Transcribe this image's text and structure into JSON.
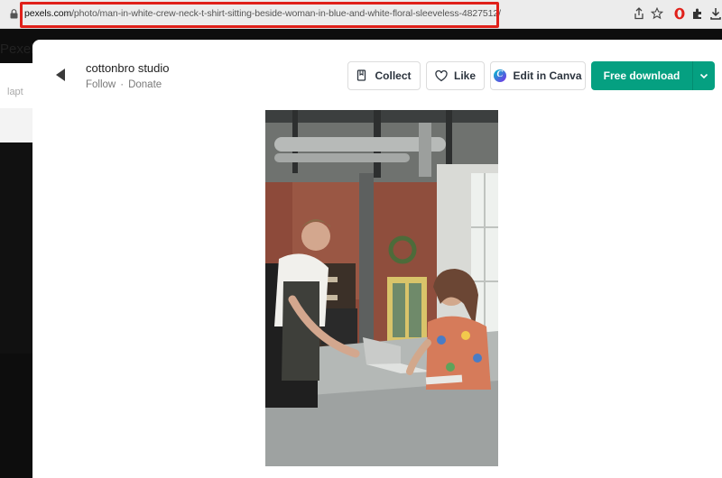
{
  "browser": {
    "url_host": "pexels.com",
    "url_path": "/photo/man-in-white-crew-neck-t-shirt-sitting-beside-woman-in-blue-and-white-floral-sleeveless-4827512/",
    "highlight_color": "#e0201a"
  },
  "background_page": {
    "logo_text": "Pexels",
    "nav_text": "lapt"
  },
  "author": {
    "name": "cottonbro studio",
    "follow": "Follow",
    "separator": "·",
    "donate": "Donate"
  },
  "actions": {
    "collect": "Collect",
    "like": "Like",
    "canva": "Edit in Canva",
    "download": "Free download"
  },
  "colors": {
    "download_green": "#05a081",
    "canva_gradient_start": "#00c4cc",
    "canva_gradient_end": "#7d2ae8"
  },
  "icons": [
    "lock-icon",
    "share-icon",
    "star-icon",
    "opera-icon",
    "extensions-icon",
    "download-icon",
    "back-arrow-icon",
    "bookmark-icon",
    "heart-icon",
    "canva-icon",
    "chevron-down-icon"
  ]
}
